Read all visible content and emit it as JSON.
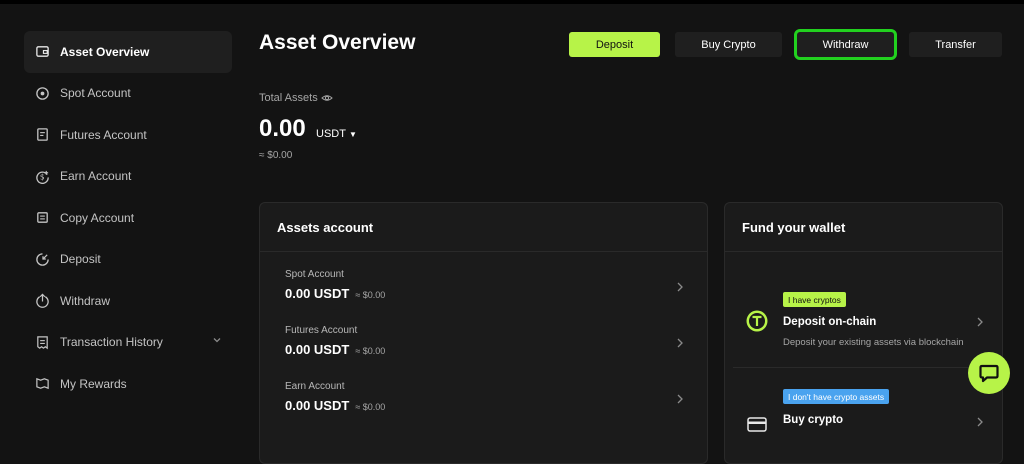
{
  "sidebar": {
    "items": [
      {
        "label": "Asset Overview",
        "icon": "wallet-icon",
        "active": true
      },
      {
        "label": "Spot Account",
        "icon": "spot-icon"
      },
      {
        "label": "Futures Account",
        "icon": "futures-icon"
      },
      {
        "label": "Earn Account",
        "icon": "earn-icon"
      },
      {
        "label": "Copy Account",
        "icon": "copy-icon"
      },
      {
        "label": "Deposit",
        "icon": "deposit-icon"
      },
      {
        "label": "Withdraw",
        "icon": "withdraw-icon"
      },
      {
        "label": "Transaction History",
        "icon": "history-icon",
        "expandable": true
      },
      {
        "label": "My Rewards",
        "icon": "rewards-icon"
      }
    ]
  },
  "header": {
    "title": "Asset Overview",
    "buttons": {
      "deposit": "Deposit",
      "buy_crypto": "Buy Crypto",
      "withdraw": "Withdraw",
      "transfer": "Transfer"
    }
  },
  "total": {
    "label": "Total Assets",
    "value": "0.00",
    "currency": "USDT",
    "approx": "≈ $0.00"
  },
  "assets_card": {
    "title": "Assets account",
    "accounts": [
      {
        "name": "Spot Account",
        "value": "0.00 USDT",
        "approx": "≈ $0.00"
      },
      {
        "name": "Futures Account",
        "value": "0.00 USDT",
        "approx": "≈ $0.00"
      },
      {
        "name": "Earn Account",
        "value": "0.00 USDT",
        "approx": "≈ $0.00"
      }
    ]
  },
  "fund_card": {
    "title": "Fund your wallet",
    "options": [
      {
        "tag": "I have cryptos",
        "title": "Deposit on-chain",
        "subtitle": "Deposit your existing assets via blockchain",
        "icon": "tether-icon"
      },
      {
        "tag": "I don't have crypto assets",
        "title": "Buy crypto",
        "subtitle": "",
        "icon": "card-icon"
      }
    ]
  },
  "colors": {
    "accent": "#b7f348",
    "highlight_outline": "#22d11f",
    "tag_blue": "#4aa3ef",
    "background": "#131313",
    "card": "#1b1b1b"
  }
}
